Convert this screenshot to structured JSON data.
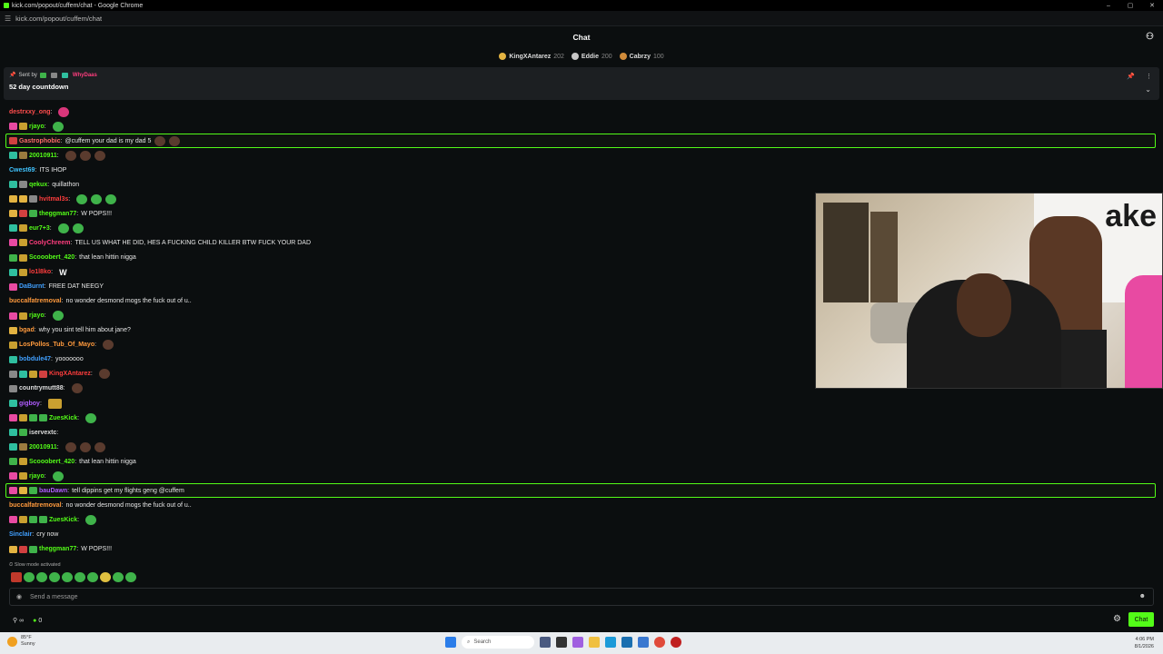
{
  "window": {
    "title": "kick.com/popout/cuffem/chat - Google Chrome",
    "url": "kick.com/popout/cuffem/chat",
    "controls": [
      "–",
      "▢",
      "✕"
    ]
  },
  "header": {
    "title": "Chat"
  },
  "leaderboard": [
    {
      "name": "KingXAntarez",
      "count": "202",
      "color": "#e3b341"
    },
    {
      "name": "Eddie",
      "count": "200",
      "color": "#c7c7c7"
    },
    {
      "name": "Cabrzy",
      "count": "100",
      "color": "#d08b3a"
    }
  ],
  "pinned": {
    "sent_by_label": "Sent by",
    "user": "WhyDaas",
    "message": "52 day countdown"
  },
  "messages": [
    {
      "user": "destrxxy_ong",
      "color": "#ff4d4d",
      "text": "",
      "badges": [],
      "emotes": [
        "p"
      ],
      "hl": false
    },
    {
      "user": "rjayo",
      "color": "#53fc18",
      "text": "",
      "badges": [
        "#e84aa2",
        "#c9a030"
      ],
      "emotes": [
        "g"
      ],
      "hl": false
    },
    {
      "user": "Gastrophobic",
      "color": "#ff6b6b",
      "text": "@cuffem your dad is my dad 5",
      "badges": [
        "#d14040"
      ],
      "emotes": [
        "d",
        "d"
      ],
      "hl": true
    },
    {
      "user": "20010911",
      "color": "#53fc18",
      "text": "",
      "badges": [
        "#2fbf9f",
        "#9b7b3f"
      ],
      "emotes": [
        "d",
        "d",
        "d"
      ],
      "hl": false
    },
    {
      "user": "Cwest69",
      "color": "#40c4ff",
      "text": "ITS IHOP",
      "badges": [],
      "emotes": [],
      "hl": false
    },
    {
      "user": "qekux",
      "color": "#53fc18",
      "text": "quillathon",
      "badges": [
        "#2fbf9f",
        "#888888"
      ],
      "emotes": [],
      "hl": false
    },
    {
      "user": "hvitmal3s",
      "color": "#ff3d3d",
      "text": "",
      "badges": [
        "#e3b341",
        "#e3b341",
        "#888888"
      ],
      "emotes": [
        "g",
        "g",
        "g"
      ],
      "hl": false
    },
    {
      "user": "theggman77",
      "color": "#53fc18",
      "text": "W POPS!!!",
      "badges": [
        "#e3b341",
        "#d14040",
        "#3fb34a"
      ],
      "emotes": [],
      "hl": false
    },
    {
      "user": "eur7+3",
      "color": "#53fc18",
      "text": "",
      "badges": [
        "#2fbf9f",
        "#c9a030"
      ],
      "emotes": [
        "g",
        "g"
      ],
      "hl": false
    },
    {
      "user": "CoolyChreem",
      "color": "#ff3d7e",
      "text": "TELL US WHAT HE DID, HES A FUCKING CHILD KILLER BTW FUCK YOUR DAD",
      "badges": [
        "#e84aa2",
        "#c9a030"
      ],
      "emotes": [],
      "hl": false
    },
    {
      "user": "Scooobert_420",
      "color": "#53fc18",
      "text": "that lean hittin nigga",
      "badges": [
        "#3fb34a",
        "#c9a030"
      ],
      "emotes": [],
      "hl": false
    },
    {
      "user": "lo1l8ko",
      "color": "#ff3d3d",
      "text": "",
      "badges": [
        "#2fbf9f",
        "#c9a030"
      ],
      "emotes": [
        "w"
      ],
      "hl": false
    },
    {
      "user": "DaBurnt",
      "color": "#40a0ff",
      "text": "FREE DAT NEEGY",
      "badges": [
        "#e84aa2"
      ],
      "emotes": [],
      "hl": false
    },
    {
      "user": "buccalfatremoval",
      "color": "#ff9a3d",
      "text": "no wonder desmond mogs the fuck out of u..",
      "badges": [],
      "emotes": [],
      "hl": false
    },
    {
      "user": "rjayo",
      "color": "#53fc18",
      "text": "",
      "badges": [
        "#e84aa2",
        "#c9a030"
      ],
      "emotes": [
        "g"
      ],
      "hl": false
    },
    {
      "user": "bgad",
      "color": "#ff9a3d",
      "text": "why you sint tell him about jane?",
      "badges": [
        "#e3b341"
      ],
      "emotes": [],
      "hl": false
    },
    {
      "user": "LosPollos_Tub_Of_Mayo",
      "color": "#ff9a3d",
      "text": "",
      "badges": [
        "#c9a030"
      ],
      "emotes": [
        "d"
      ],
      "hl": false
    },
    {
      "user": "bobdule47",
      "color": "#40a0ff",
      "text": "yooooooo",
      "badges": [
        "#2fbf9f"
      ],
      "emotes": [],
      "hl": false
    },
    {
      "user": "KingXAntarez",
      "color": "#ff3d3d",
      "text": "",
      "badges": [
        "#888888",
        "#2fbf9f",
        "#c9a030",
        "#d14040"
      ],
      "emotes": [
        "d"
      ],
      "hl": false
    },
    {
      "user": "countrymutt88",
      "color": "#dddddd",
      "text": "",
      "badges": [
        "#888888"
      ],
      "emotes": [
        "d"
      ],
      "hl": false
    },
    {
      "user": "gigboy",
      "color": "#b05cff",
      "text": "",
      "badges": [
        "#2fbf9f"
      ],
      "emotes": [
        "y"
      ],
      "hl": false
    },
    {
      "user": "ZuesKick",
      "color": "#53fc18",
      "text": "",
      "badges": [
        "#e84aa2",
        "#c9a030",
        "#3fb34a",
        "#3fb34a"
      ],
      "emotes": [
        "g"
      ],
      "hl": false
    },
    {
      "user": "iservextc",
      "color": "#dddddd",
      "text": "",
      "badges": [
        "#2fbf9f",
        "#3fb34a"
      ],
      "emotes": [],
      "hl": false
    },
    {
      "user": "20010911",
      "color": "#53fc18",
      "text": "",
      "badges": [
        "#2fbf9f",
        "#9b7b3f"
      ],
      "emotes": [
        "d",
        "d",
        "d"
      ],
      "hl": false
    },
    {
      "user": "Scooobert_420",
      "color": "#53fc18",
      "text": "that lean hittin nigga",
      "badges": [
        "#3fb34a",
        "#c9a030"
      ],
      "emotes": [],
      "hl": false
    },
    {
      "user": "rjayo",
      "color": "#53fc18",
      "text": "",
      "badges": [
        "#e84aa2",
        "#c9a030"
      ],
      "emotes": [
        "g"
      ],
      "hl": false
    },
    {
      "user": "bauDawn",
      "color": "#b05cff",
      "text": "tell dippins get my flights geng @cuffem",
      "badges": [
        "#e84aa2",
        "#e3b341",
        "#3fb34a"
      ],
      "emotes": [],
      "hl": true
    },
    {
      "user": "buccalfatremoval",
      "color": "#ff9a3d",
      "text": "no wonder desmond mogs the fuck out of u..",
      "badges": [],
      "emotes": [],
      "hl": false
    },
    {
      "user": "ZuesKick",
      "color": "#53fc18",
      "text": "",
      "badges": [
        "#e84aa2",
        "#c9a030",
        "#3fb34a",
        "#3fb34a"
      ],
      "emotes": [
        "g"
      ],
      "hl": false
    },
    {
      "user": "Sinclair",
      "color": "#40a0ff",
      "text": "cry now",
      "badges": [],
      "emotes": [],
      "hl": false
    },
    {
      "user": "theggman77",
      "color": "#53fc18",
      "text": "W POPS!!!",
      "badges": [
        "#e3b341",
        "#d14040",
        "#3fb34a"
      ],
      "emotes": [],
      "hl": false
    }
  ],
  "video": {
    "brand_text": "ake"
  },
  "slow_mode": "Slow mode activated",
  "input": {
    "placeholder": "Send a message"
  },
  "bottom": {
    "viewers_icon": "∞",
    "points": "0",
    "chat_button": "Chat"
  },
  "taskbar": {
    "temperature": "85°F",
    "weather": "Sunny",
    "search_label": "Search",
    "time": "4:06 PM",
    "date": "8/1/2026"
  }
}
